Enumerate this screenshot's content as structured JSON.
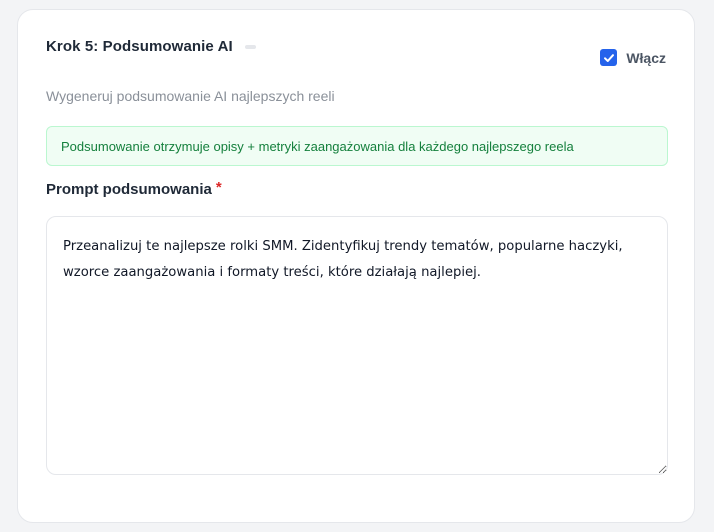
{
  "step": {
    "title": "Krok 5: Podsumowanie AI",
    "description": "Wygeneruj podsumowanie AI najlepszych reeli",
    "enable_label": "Włącz",
    "enabled": true
  },
  "info": {
    "text": "Podsumowanie otrzymuje opisy + metryki zaangażowania dla każdego najlepszego reela"
  },
  "prompt": {
    "label": "Prompt podsumowania",
    "required_mark": "*",
    "value": "Przeanalizuj te najlepsze rolki SMM. Zidentyfikuj trendy tematów, popularne haczyki, wzorce zaangażowania i formaty treści, które działają najlepiej."
  },
  "colors": {
    "accent": "#2563eb",
    "info_bg": "#f0fdf4",
    "info_text": "#15803d",
    "required": "#dc2626"
  },
  "icons": {
    "checkbox": "check-icon"
  }
}
